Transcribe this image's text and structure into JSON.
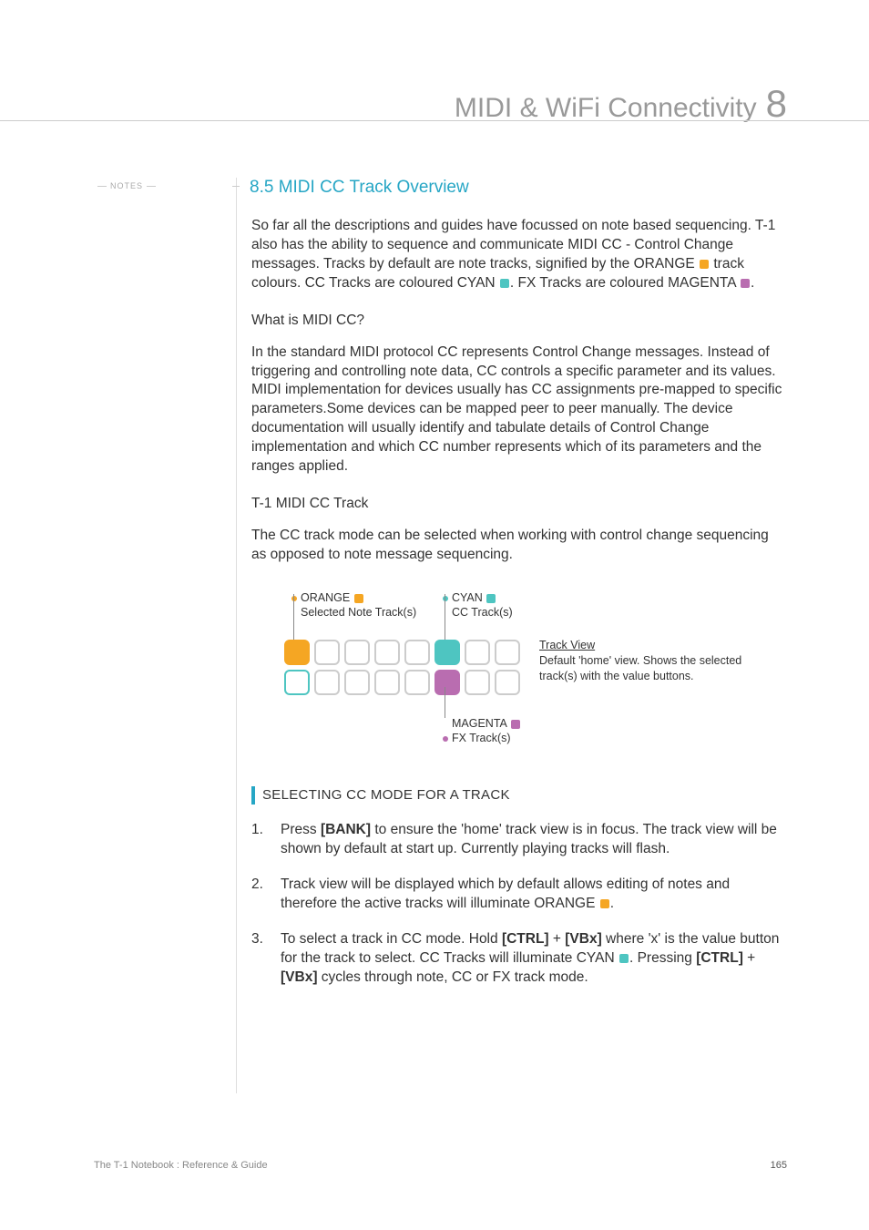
{
  "header": {
    "title": "MIDI & WiFi Connectivity",
    "chapter_number": "8"
  },
  "sidebar": {
    "notes_label": "NOTES"
  },
  "section": {
    "number": "8.5",
    "title": "MIDI CC Track Overview"
  },
  "intro": {
    "p0a": "So far all the descriptions and guides have focussed on note based sequencing. T-1 also has the ability to sequence and communicate MIDI CC - Control Change messages. Tracks by default are note tracks, signified by the ORANGE ",
    "p0b": " track colours. CC Tracks are coloured CYAN ",
    "p0c": ". FX Tracks are coloured MAGENTA ",
    "p0d": "."
  },
  "what": {
    "heading": "What is MIDI CC?",
    "body": "In the standard MIDI protocol CC represents Control Change messages. Instead of triggering and controlling note data, CC controls a specific parameter and its values. MIDI implementation for devices usually has CC assignments pre-mapped to specific parameters.Some devices can be mapped peer to peer manually. The device documentation will usually identify and tabulate details of Control Change implementation and which CC number represents which of its parameters and the ranges applied."
  },
  "trackmode": {
    "heading": "T-1 MIDI CC Track",
    "body": "The CC track mode can be selected when working with control change sequencing as opposed to note message sequencing."
  },
  "diagram": {
    "orange_label": "ORANGE",
    "orange_sub": "Selected Note Track(s)",
    "cyan_label": "CYAN",
    "cyan_sub": "CC Track(s)",
    "magenta_label": "MAGENTA",
    "magenta_sub": "FX Track(s)",
    "side_title": "Track View",
    "side_body": "Default 'home' view. Shows the selected track(s) with the value buttons."
  },
  "procedure": {
    "heading": "SELECTING CC MODE FOR A TRACK",
    "steps": {
      "s1_num": "1.",
      "s1a": "Press ",
      "s1_bank": "[BANK]",
      "s1b": " to ensure the 'home' track view is in focus. The track view will be shown by default at start up. Currently playing tracks will flash.",
      "s2_num": "2.",
      "s2a": "Track view will be displayed which by default allows editing of notes and therefore the active tracks will illuminate ORANGE ",
      "s2b": ".",
      "s3_num": "3.",
      "s3a": "To select a track in CC mode. Hold ",
      "s3_ctrl1": "[CTRL]",
      "s3_plus1": " + ",
      "s3_vbx1": "[VBx]",
      "s3b": " where 'x' is the value button for the track to select. CC Tracks will illuminate CYAN ",
      "s3c": ". Pressing ",
      "s3_ctrl2": "[CTRL]",
      "s3_plus2": " + ",
      "s3_vbx2": "[VBx]",
      "s3d": " cycles through note, CC or FX track mode."
    }
  },
  "footer": {
    "left": "The T-1 Notebook : Reference & Guide",
    "page": "165"
  }
}
